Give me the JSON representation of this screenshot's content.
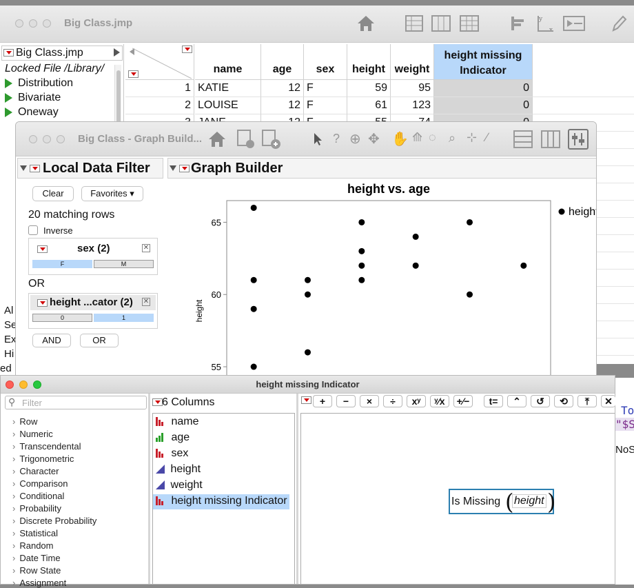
{
  "datatable": {
    "title": "Big Class.jmp",
    "panel_title": "Big Class.jmp",
    "locked_label": "Locked File  /Library/",
    "scripts": [
      "Distribution",
      "Bivariate",
      "Oneway"
    ],
    "left_partial": [
      "Al",
      "Se",
      "Ex",
      "Hi",
      "ed"
    ],
    "columns": [
      "name",
      "age",
      "sex",
      "height",
      "weight"
    ],
    "selected_column": [
      "height missing",
      "Indicator"
    ],
    "rows": [
      {
        "num": "1",
        "name": "KATIE",
        "age": "12",
        "sex": "F",
        "height": "59",
        "weight": "95",
        "ind": "0"
      },
      {
        "num": "2",
        "name": "LOUISE",
        "age": "12",
        "sex": "F",
        "height": "61",
        "weight": "123",
        "ind": "0"
      },
      {
        "num": "3",
        "name": "JANE",
        "age": "12",
        "sex": "F",
        "height": "55",
        "weight": "74",
        "ind": "0"
      }
    ]
  },
  "graphbuilder": {
    "title": "Big Class - Graph Build...",
    "ldf_title": "Local Data Filter",
    "gb_title": "Graph Builder",
    "clear": "Clear",
    "favorites": "Favorites ▾",
    "matching": "20 matching rows",
    "inverse": "Inverse",
    "filter1_title": "sex (2)",
    "filter1_levels": [
      "F",
      "M"
    ],
    "or_label": "OR",
    "filter2_title": "height ...cator (2)",
    "filter2_levels": [
      "0",
      "1"
    ],
    "and_btn": "AND",
    "or_btn": "OR"
  },
  "chart_data": {
    "type": "scatter",
    "title": "height vs. age",
    "xlabel": "",
    "ylabel": "height",
    "ylim": [
      54,
      66.5
    ],
    "yticks": [
      55,
      60,
      65
    ],
    "xlim": [
      11.5,
      17.5
    ],
    "legend": "height",
    "legend_position": "right",
    "points": [
      [
        12,
        66
      ],
      [
        12,
        61
      ],
      [
        12,
        59
      ],
      [
        12,
        55
      ],
      [
        13,
        61
      ],
      [
        13,
        60
      ],
      [
        13,
        56
      ],
      [
        14,
        65
      ],
      [
        14,
        63
      ],
      [
        14,
        62
      ],
      [
        14,
        61
      ],
      [
        15,
        64
      ],
      [
        15,
        62
      ],
      [
        16,
        65
      ],
      [
        16,
        60
      ],
      [
        17,
        62
      ]
    ]
  },
  "formula": {
    "title": "height missing Indicator",
    "filter_placeholder": "Filter",
    "columns_header": "6 Columns",
    "categories": [
      "Row",
      "Numeric",
      "Transcendental",
      "Trigonometric",
      "Character",
      "Comparison",
      "Conditional",
      "Probability",
      "Discrete Probability",
      "Statistical",
      "Random",
      "Date Time",
      "Row State",
      "Assignment"
    ],
    "columns": [
      {
        "name": "name",
        "kind": "nominal"
      },
      {
        "name": "age",
        "kind": "ordinal"
      },
      {
        "name": "sex",
        "kind": "nominal"
      },
      {
        "name": "height",
        "kind": "continuous"
      },
      {
        "name": "weight",
        "kind": "continuous"
      },
      {
        "name": "height missing Indicator",
        "kind": "nominal"
      }
    ],
    "buttons": [
      "+",
      "−",
      "×",
      "÷",
      "xʸ",
      "ʸ⁄x",
      "+⁄−",
      "t=",
      "⌃",
      "↺",
      "⟲",
      "⤒",
      "✕"
    ],
    "expr_fn": "Is Missing",
    "expr_arg": "height",
    "right_partial": [
      "To",
      "\"$S",
      "NoS"
    ]
  }
}
